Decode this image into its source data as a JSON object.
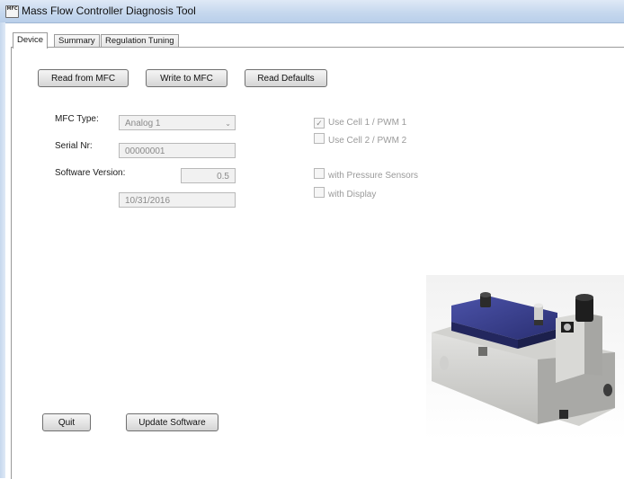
{
  "window": {
    "title": "Mass Flow Controller Diagnosis Tool",
    "icon_glyph": "MFC"
  },
  "tabs": [
    {
      "label": "Device",
      "active": true
    },
    {
      "label": "Summary",
      "active": false
    },
    {
      "label": "Regulation Tuning",
      "active": false
    }
  ],
  "toolbar": {
    "read_label": "Read from MFC",
    "write_label": "Write to MFC",
    "defaults_label": "Read Defaults"
  },
  "device": {
    "mfc_type_label": "MFC Type:",
    "mfc_type_value": "Analog 1",
    "serial_label": "Serial Nr:",
    "serial_value": "00000001",
    "software_label": "Software Version:",
    "software_value": "0.5",
    "date_value": "10/31/2016"
  },
  "options": {
    "cell1": {
      "label": "Use Cell 1 / PWM 1",
      "checked": true
    },
    "cell2": {
      "label": "Use Cell 2 / PWM 2",
      "checked": false
    },
    "pressure": {
      "label": "with Pressure Sensors",
      "checked": false
    },
    "display": {
      "label": "with Display",
      "checked": false
    }
  },
  "footer": {
    "quit_label": "Quit",
    "update_label": "Update Software"
  },
  "icons": {
    "combo_arrow": "chevron-down-icon",
    "check": "checkmark-icon"
  },
  "colors": {
    "titlebar": "#c6d8ee",
    "device_top": "#3a3f8f",
    "device_body": "#d8d8d6"
  }
}
